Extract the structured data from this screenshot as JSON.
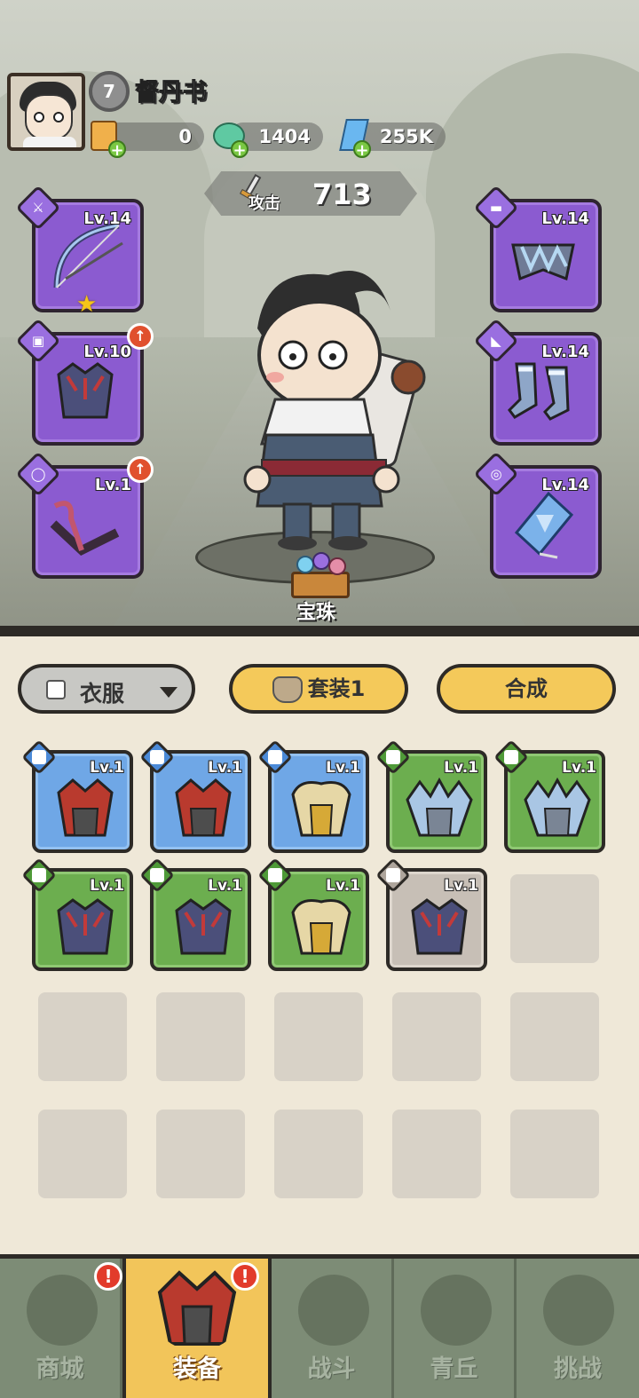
{
  "player": {
    "level": "7",
    "name": "督丹书"
  },
  "resources": [
    {
      "name": "voucher",
      "icon": "voucher-icon",
      "value": "0"
    },
    {
      "name": "jade",
      "icon": "jade-dragon-icon",
      "value": "1404"
    },
    {
      "name": "crystal",
      "icon": "crystal-icon",
      "value": "255K"
    }
  ],
  "stats": {
    "attack_label": "攻击",
    "attack_value": "713"
  },
  "equip_slots": {
    "weapon": {
      "level": "Lv.14",
      "icon": "bow-icon"
    },
    "clothes": {
      "level": "Lv.10",
      "icon": "armor-icon"
    },
    "belt": {
      "level": "Lv.1",
      "icon": "belt-icon"
    },
    "pants": {
      "level": "Lv.14",
      "icon": "pants-icon"
    },
    "boots": {
      "level": "Lv.14",
      "icon": "boots-icon"
    },
    "accessory": {
      "level": "Lv.14",
      "icon": "amulet-icon"
    }
  },
  "gem_label": "宝珠",
  "filters": {
    "category": "衣服",
    "set_label": "套装1",
    "merge_label": "合成"
  },
  "inventory": [
    {
      "level": "Lv.1",
      "rarity": "blue",
      "item": "red-armor"
    },
    {
      "level": "Lv.1",
      "rarity": "blue",
      "item": "red-armor"
    },
    {
      "level": "Lv.1",
      "rarity": "blue",
      "item": "gold-armor"
    },
    {
      "level": "Lv.1",
      "rarity": "green",
      "item": "ice-armor"
    },
    {
      "level": "Lv.1",
      "rarity": "green",
      "item": "ice-armor"
    },
    {
      "level": "Lv.1",
      "rarity": "green",
      "item": "dark-armor"
    },
    {
      "level": "Lv.1",
      "rarity": "green",
      "item": "dark-armor"
    },
    {
      "level": "Lv.1",
      "rarity": "green",
      "item": "gold-armor"
    },
    {
      "level": "Lv.1",
      "rarity": "gray",
      "item": "dark-armor"
    }
  ],
  "nav": [
    {
      "label": "商城",
      "icon": "shop-icon",
      "alert": "!"
    },
    {
      "label": "装备",
      "icon": "equipment-icon",
      "alert": "!"
    },
    {
      "label": "战斗",
      "icon": "crossed-swords-icon"
    },
    {
      "label": "青丘",
      "icon": "mountain-icon"
    },
    {
      "label": "挑战",
      "icon": "challenge-orb-icon"
    }
  ],
  "colors": {
    "rare_purple": "#8b5bd0",
    "blue": "#6fa7e6",
    "green": "#6cae4f",
    "gray": "#c7bfb6",
    "accent_yellow": "#f4c95a"
  }
}
